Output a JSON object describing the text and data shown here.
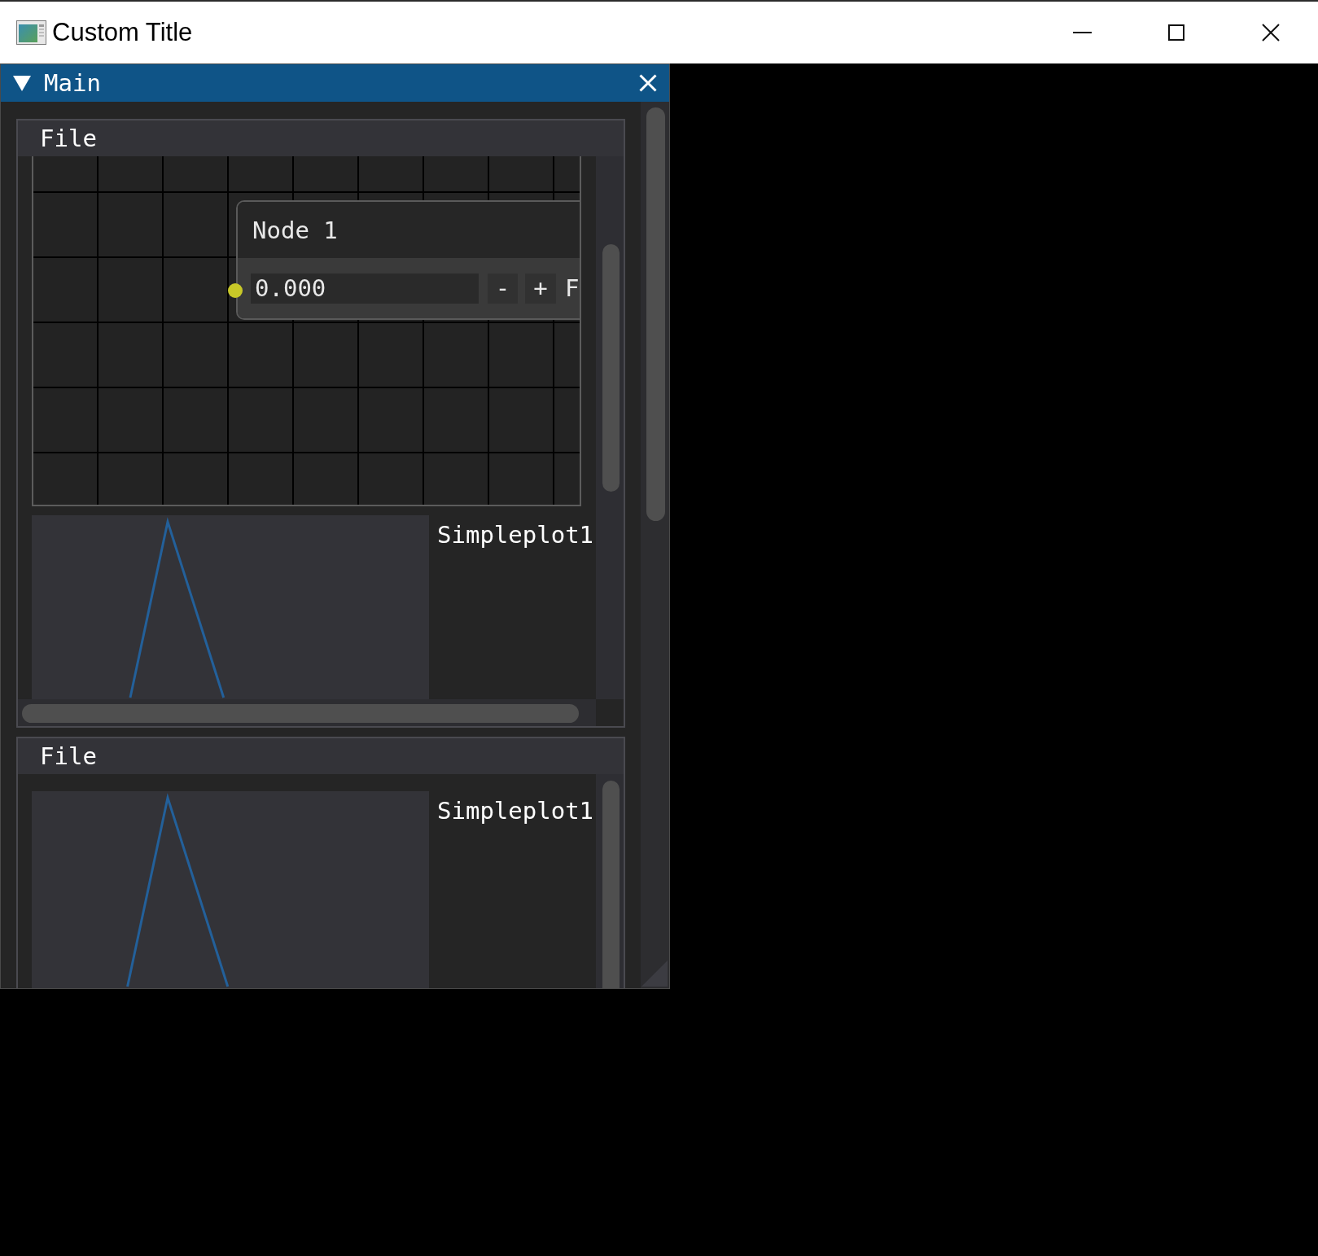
{
  "window": {
    "title": "Custom Title"
  },
  "main_panel": {
    "title": "Main",
    "expanded": true,
    "panels": [
      {
        "menu": [
          "File"
        ],
        "node_editor": {
          "nodes": [
            {
              "title": "Node 1",
              "value": "0.000",
              "buttons": [
                "-",
                "+"
              ],
              "label": "F"
            }
          ]
        },
        "plot": {
          "label": "Simpleplot1"
        }
      },
      {
        "menu": [
          "File"
        ],
        "plot": {
          "label": "Simpleplot1"
        }
      }
    ]
  }
}
